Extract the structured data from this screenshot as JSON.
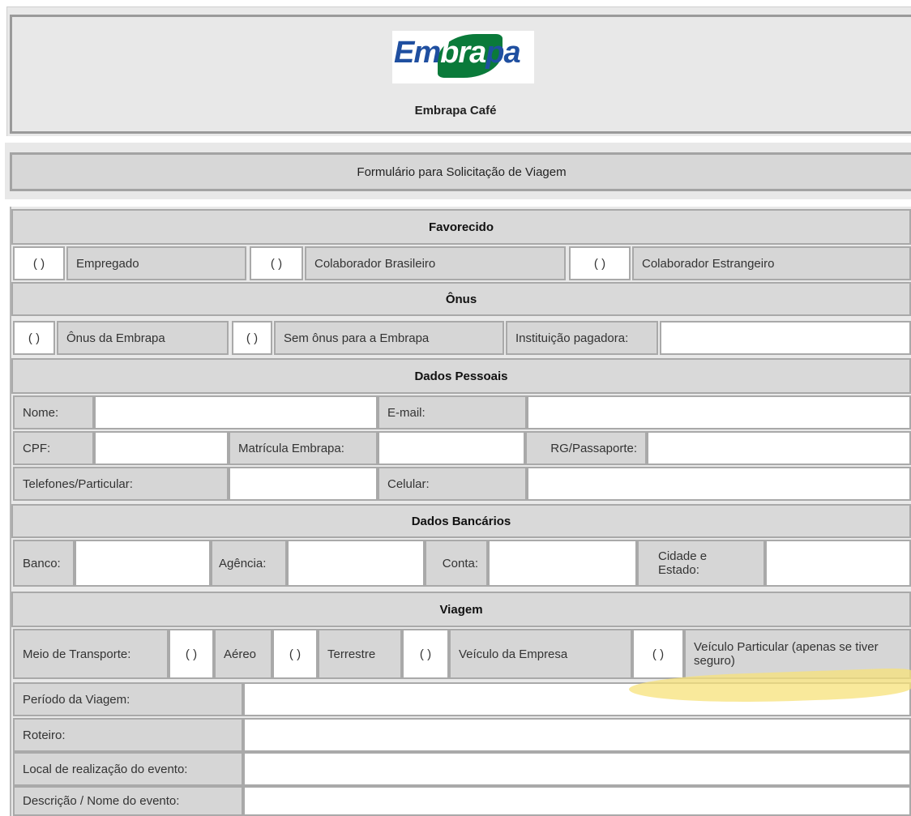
{
  "header": {
    "logo_text_em": "Em",
    "logo_text_brap": "bra",
    "logo_text_pa": "pa",
    "unit_name": "Embrapa Café",
    "form_title": "Formulário para Solicitação de Viagem"
  },
  "checkbox_mark": "( )",
  "favorecido": {
    "heading": "Favorecido",
    "opt1": "Empregado",
    "opt2": "Colaborador Brasileiro",
    "opt3": "Colaborador Estrangeiro"
  },
  "onus": {
    "heading": "Ônus",
    "opt1": "Ônus da Embrapa",
    "opt2": "Sem ônus para a Embrapa",
    "payer_label": "Instituição pagadora:"
  },
  "dados_pessoais": {
    "heading": "Dados Pessoais",
    "nome": "Nome:",
    "email": "E-mail:",
    "cpf": "CPF:",
    "matricula": "Matrícula Embrapa:",
    "rg": "RG/Passaporte:",
    "telefones": "Telefones/Particular:",
    "celular": "Celular:"
  },
  "dados_bancarios": {
    "heading": "Dados Bancários",
    "banco": "Banco:",
    "agencia": "Agência:",
    "conta": "Conta:",
    "cidade": "Cidade e Estado:"
  },
  "viagem": {
    "heading": "Viagem",
    "meio": "Meio de Transporte:",
    "aereo": "Aéreo",
    "terrestre": "Terrestre",
    "veiculo_empresa": "Veículo da Empresa",
    "veiculo_particular": "Veículo Particular (apenas se tiver seguro)",
    "periodo": "Período da Viagem:",
    "roteiro": "Roteiro:",
    "local": "Local de realização do evento:",
    "descricao": "Descrição / Nome do evento:"
  },
  "colors": {
    "highlight": "#f7e17a",
    "logo_blue": "#1f4fa0",
    "logo_green": "#0a7a3a"
  }
}
